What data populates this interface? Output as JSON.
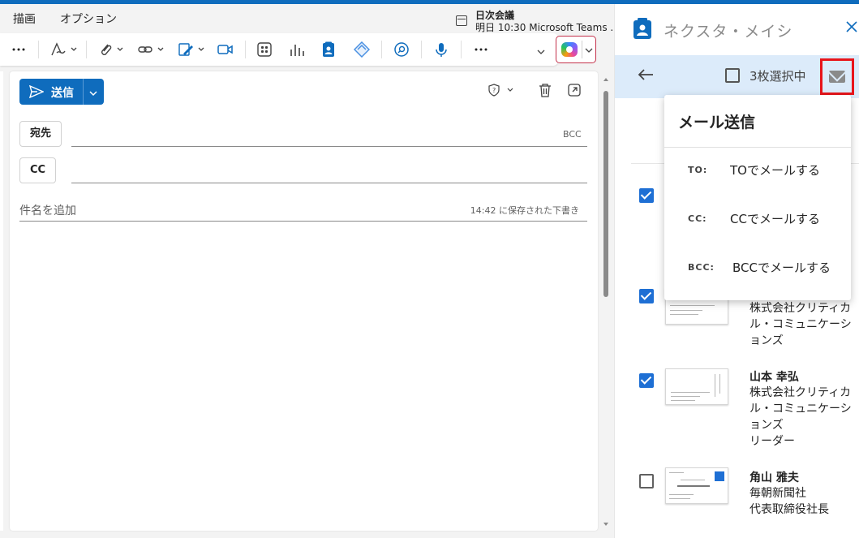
{
  "menu": {
    "items": [
      "描画",
      "オプション"
    ]
  },
  "meeting": {
    "title": "日次会議",
    "detail": "明日 10:30 Microsoft Teams ..."
  },
  "compose": {
    "send_label": "送信",
    "to_label": "宛先",
    "cc_label": "CC",
    "bcc_label": "BCC",
    "subject_placeholder": "件名を追加",
    "saved_status": "14:42 に保存された下書き"
  },
  "pane": {
    "title": "ネクスタ・メイシ",
    "selection_label": "3枚選択中",
    "dropdown": {
      "title": "メール送信",
      "items": [
        {
          "key": "TO:",
          "label": "TOでメールする"
        },
        {
          "key": "CC:",
          "label": "CCでメールする"
        },
        {
          "key": "BCC:",
          "label": "BCCでメールする"
        }
      ]
    },
    "contacts": [
      {
        "checked": true,
        "name": "",
        "company": "",
        "title": ""
      },
      {
        "checked": true,
        "name": "",
        "company": "株式会社クリティカル・コミュニケーションズ",
        "title": ""
      },
      {
        "checked": true,
        "name": "山本 幸弘",
        "company": "株式会社クリティカル・コミュニケーションズ",
        "title": "リーダー"
      },
      {
        "checked": false,
        "name": "角山 雅夫",
        "company": "毎朝新聞社",
        "title": "代表取締役社長"
      }
    ]
  },
  "colors": {
    "accent": "#0f6cbd",
    "selection_bar": "#dcebfa",
    "highlight_box": "#e8151b",
    "checkbox": "#1e6fd4"
  }
}
